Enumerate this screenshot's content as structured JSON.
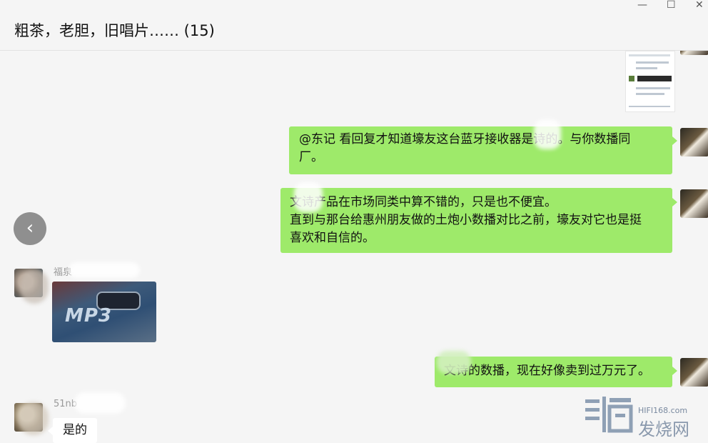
{
  "window": {
    "title": "粗茶，老胆，旧唱片…… (15)",
    "controls": {
      "minimize": "—",
      "maximize": "☐",
      "close": "✕"
    }
  },
  "messages": [
    {
      "id": "m1",
      "side": "me",
      "type": "image",
      "content": "screenshot"
    },
    {
      "id": "m2",
      "side": "me",
      "type": "text",
      "lines": [
        "@东记 看回复才知道壕友这台蓝牙接收器是",
        "诗的。与你数播同",
        "厂。"
      ]
    },
    {
      "id": "m3",
      "side": "me",
      "type": "text",
      "lines": [
        "文诗产品在市场同类中算不错的，只是也不便宜。",
        "直到与那台给惠州朋友做的土炮小数播对比之前，壕友对它也是挺",
        "喜欢和自信的。"
      ]
    },
    {
      "id": "m4",
      "side": "other",
      "type": "image",
      "sender": "福泉",
      "caption": "MP3"
    },
    {
      "id": "m5",
      "side": "me",
      "type": "text",
      "lines": [
        "文诗的数播，现在好像卖到过万元了。"
      ]
    },
    {
      "id": "m6",
      "side": "other",
      "type": "text",
      "sender": "51nb",
      "lines": [
        "是的"
      ]
    }
  ],
  "watermark": {
    "url": "HIFI168.com",
    "name": "发烧网"
  },
  "colors": {
    "my_bubble": "#9eea6a",
    "other_bubble": "#ffffff",
    "background": "#f5f5f5"
  },
  "icons": {
    "back": "chevron-left-icon"
  }
}
